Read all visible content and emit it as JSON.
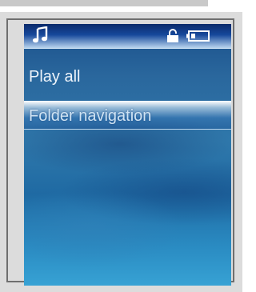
{
  "status_bar": {
    "icons": [
      "music-note-icon",
      "lock-icon",
      "battery-icon"
    ]
  },
  "menu": {
    "items": [
      {
        "label": "Play all",
        "selected": false
      },
      {
        "label": "Folder navigation",
        "selected": true
      }
    ]
  },
  "colors": {
    "frame": "#dcdcdc",
    "frame_border": "#6f6f6f",
    "screen_top": "#1a4f8a",
    "screen_bottom": "#37a2d4",
    "text": "#eef4fb"
  }
}
